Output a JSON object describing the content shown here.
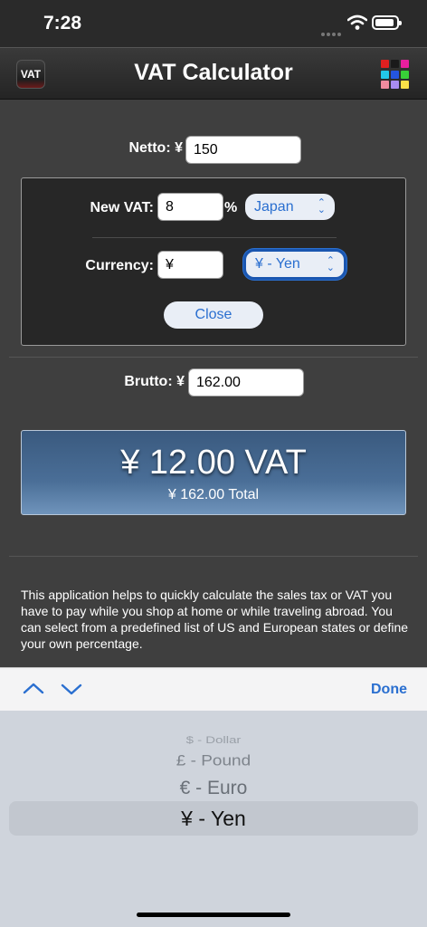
{
  "status_bar": {
    "time": "7:28"
  },
  "nav": {
    "app_icon_label": "VAT",
    "title": "VAT Calculator",
    "color_grid": [
      "#e02020",
      "#1a1a1a",
      "#e81ea0",
      "#22c8e8",
      "#2455e0",
      "#38d038",
      "#f08b9e",
      "#a88cf0",
      "#f8e048"
    ]
  },
  "form": {
    "netto_label": "Netto: ¥",
    "netto_value": "150",
    "new_vat_label": "New VAT:",
    "new_vat_value": "8",
    "percent_sign": "%",
    "country_select": "Japan",
    "currency_label": "Currency:",
    "currency_symbol_value": "¥",
    "currency_select": "¥ - Yen",
    "close_label": "Close",
    "brutto_label": "Brutto: ¥",
    "brutto_value": "162.00"
  },
  "result": {
    "vat_amount": "¥ 12.00 VAT",
    "total_amount": "¥ 162.00 Total"
  },
  "description": "This application helps to quickly calculate the sales tax or VAT you have to pay while you shop at home or while traveling abroad. You can select from a predefined list of US and European states or define your own percentage.",
  "keyboard_accessory": {
    "done_label": "Done"
  },
  "picker": {
    "options": [
      "$ - Dollar",
      "£ - Pound",
      "€ - Euro",
      "¥ - Yen"
    ],
    "selected": "¥ - Yen"
  }
}
